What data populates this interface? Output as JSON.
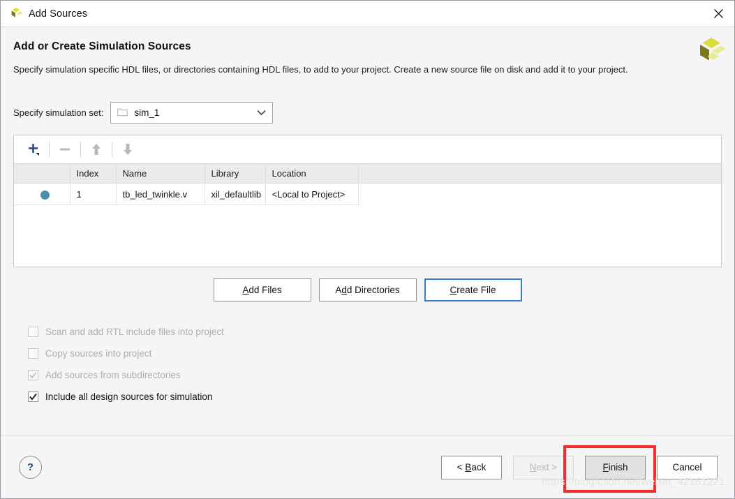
{
  "window": {
    "title": "Add Sources",
    "icon": "xilinx-logo-icon",
    "close_icon": "close-icon"
  },
  "header": {
    "title": "Add or Create Simulation Sources",
    "description": "Specify simulation specific HDL files, or directories containing HDL files, to add to your project. Create a new source file on disk and add it to your project.",
    "logo_icon": "xilinx-logo-icon"
  },
  "simulation_set": {
    "label": "Specify simulation set:",
    "value": "sim_1",
    "folder_icon": "folder-icon",
    "chevron_icon": "chevron-down-icon"
  },
  "toolbar": {
    "add_label": "+",
    "remove_label": "−",
    "move_up_label": "↑",
    "move_down_label": "↓"
  },
  "table": {
    "columns": [
      "",
      "Index",
      "Name",
      "Library",
      "Location",
      ""
    ],
    "rows": [
      {
        "status": "●",
        "index": "1",
        "name": "tb_led_twinkle.v",
        "library": "xil_defaultlib",
        "location": "<Local to Project>"
      }
    ]
  },
  "file_buttons": [
    {
      "name": "add-files-button",
      "pre": "A",
      "mnemonic": "",
      "text": "Add Files",
      "focused": false
    },
    {
      "name": "add-directories-button",
      "text": "Add Directories",
      "focused": false
    },
    {
      "name": "create-file-button",
      "text": "Create File",
      "focused": true
    }
  ],
  "checkboxes": [
    {
      "label": "Scan and add RTL include files into project",
      "checked": false,
      "enabled": false
    },
    {
      "label": "Copy sources into project",
      "checked": false,
      "enabled": false
    },
    {
      "label": "Add sources from subdirectories",
      "checked": true,
      "enabled": false
    },
    {
      "label": "Include all design sources for simulation",
      "checked": true,
      "enabled": true
    }
  ],
  "footer": {
    "help_label": "?",
    "back_label": "< Back",
    "next_label": "Next >",
    "finish_label": "Finish",
    "cancel_label": "Cancel"
  },
  "annotation": {
    "highlight_target": "finish-button",
    "color": "#fa2a2a"
  },
  "watermark": {
    "text": "https://blog.csdn.net/weixin_42151221"
  }
}
